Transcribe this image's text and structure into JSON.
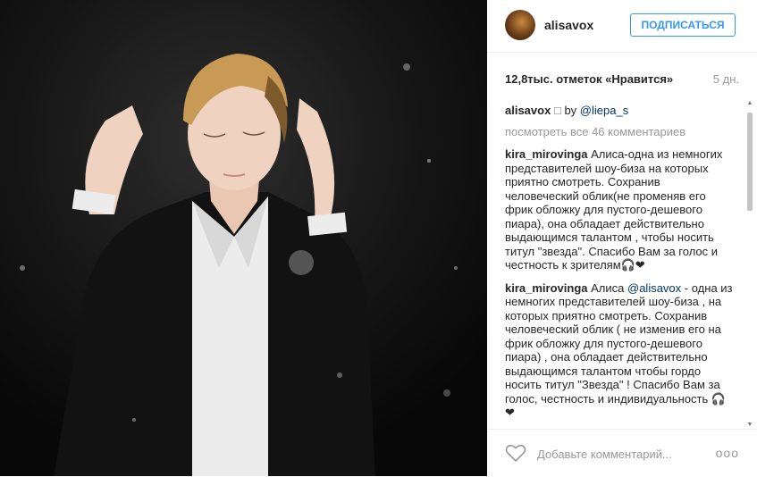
{
  "post": {
    "username": "alisavox",
    "follow_label": "ПОДПИСАТЬСЯ",
    "likes": "12,8тыс. отметок «Нравится»",
    "age": "5 дн.",
    "caption": {
      "username": "alisavox",
      "symbol": "□",
      "by": "by",
      "mention": "@liepa_s"
    },
    "view_all": "посмотреть все 46 комментариев",
    "comments": [
      {
        "username": "kira_mirovinga",
        "text": "Алиса-одна из немногих представителей шоу-биза на которых приятно смотреть. Сохранив человеческий облик(не променяв его фрик обложку для пустого-дешевого пиара), она обладает действительно выдающимся талантом , чтобы носить титул \"звезда\". Спасибо Вам за голос и честность к зрителям🎧❤"
      },
      {
        "username": "kira_mirovinga",
        "text_before": "Алиса",
        "mention": "@alisavox",
        "text_after": "- одна из немногих представителей шоу-биза , на которых приятно смотреть. Сохранив человеческий облик ( не изменив его на фрик обложку для пустого-дешевого пиара) , она обладает действительно выдающимся талантом чтобы гордо носить титул \"Звезда\" ! Спасибо Вам за голос, честность и индивидуальность 🎧❤"
      }
    ],
    "add_comment_placeholder": "Добавьте комментарий...",
    "more_label": "ooo"
  },
  "icons": {
    "heart": "heart-icon",
    "more": "more-options-icon"
  }
}
